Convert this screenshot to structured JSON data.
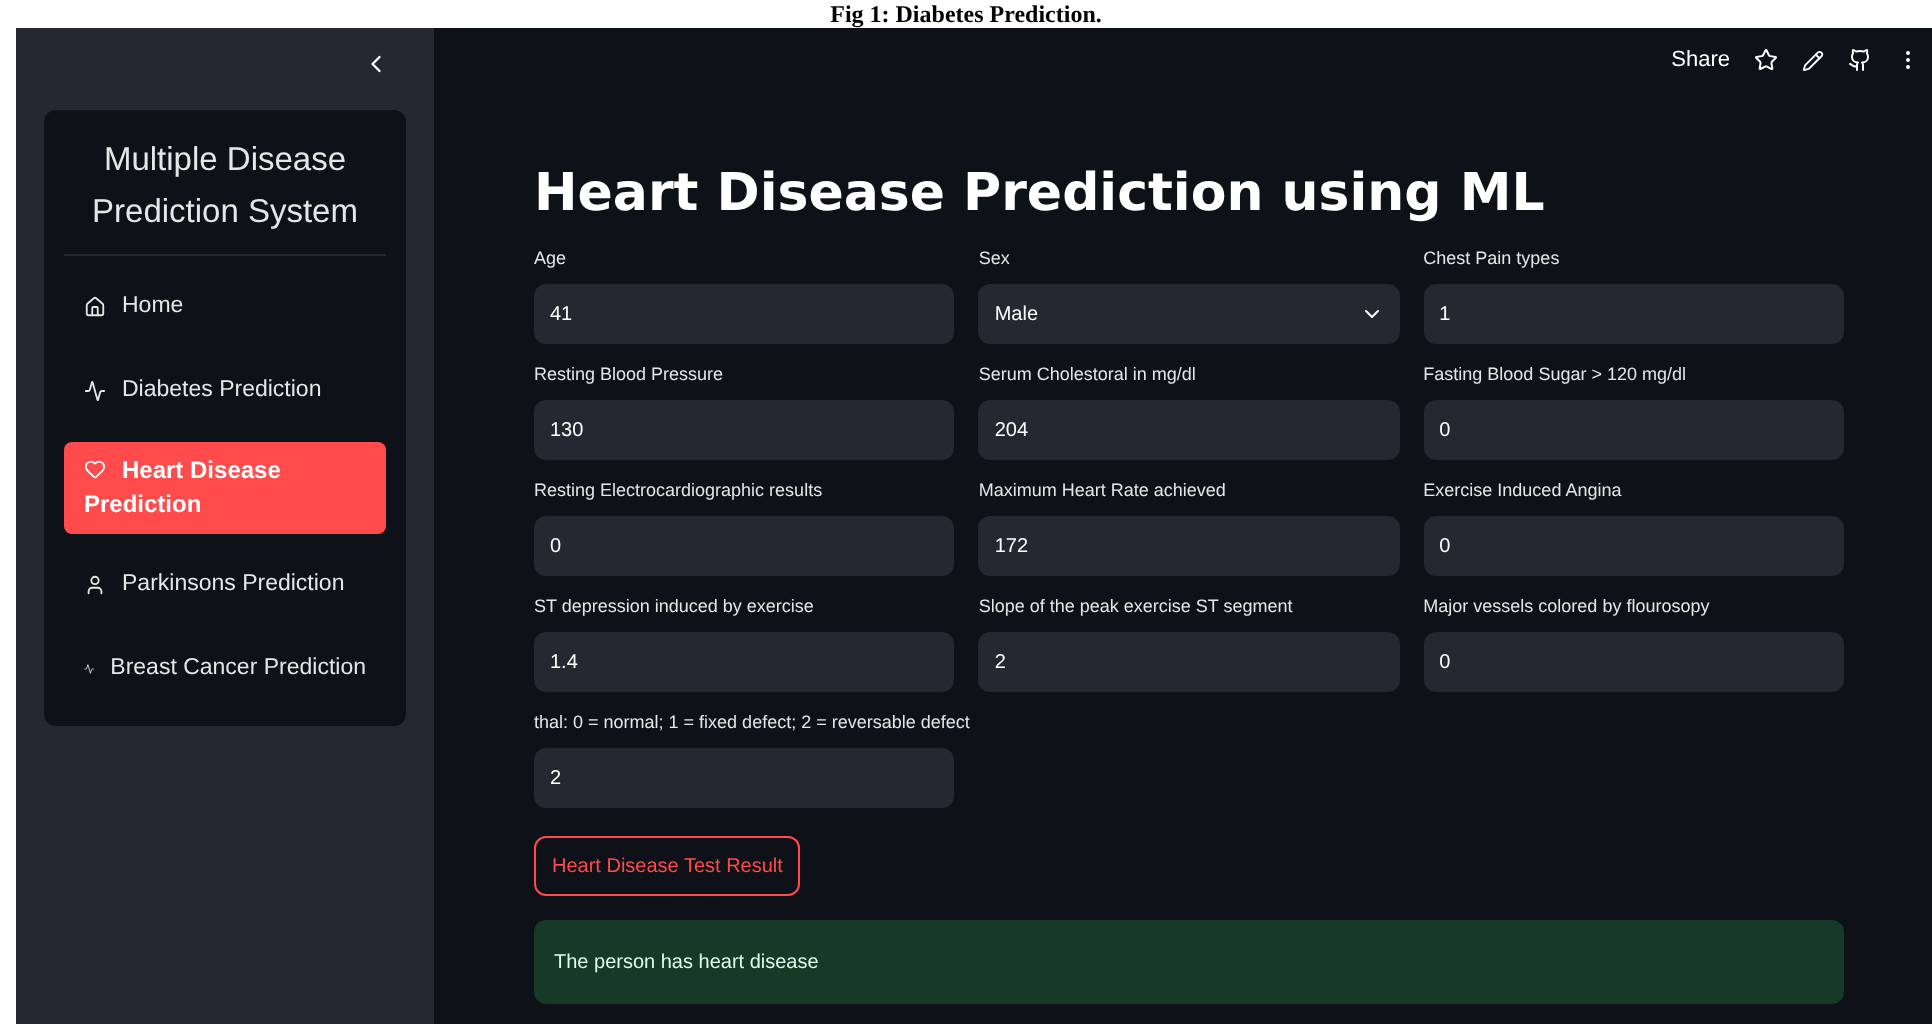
{
  "caption": "Fig 1: Diabetes Prediction.",
  "toolbar": {
    "share": "Share"
  },
  "sidebar": {
    "title": "Multiple Disease Prediction System",
    "items": [
      {
        "label": "Home",
        "kind": "home",
        "selected": false
      },
      {
        "label": "Diabetes Prediction",
        "kind": "pulse",
        "selected": false
      },
      {
        "label": "Heart Disease Prediction",
        "kind": "heart",
        "selected": true
      },
      {
        "label": "Parkinsons Prediction",
        "kind": "person",
        "selected": false
      },
      {
        "label": "Breast Cancer Prediction",
        "kind": "pulse",
        "selected": false
      }
    ]
  },
  "page_title": "Heart Disease Prediction using ML",
  "fields": [
    {
      "label": "Age",
      "value": "41",
      "kind": "number"
    },
    {
      "label": "Sex",
      "value": "Male",
      "kind": "select"
    },
    {
      "label": "Chest Pain types",
      "value": "1",
      "kind": "number"
    },
    {
      "label": "Resting Blood Pressure",
      "value": "130",
      "kind": "number"
    },
    {
      "label": "Serum Cholestoral in mg/dl",
      "value": "204",
      "kind": "number"
    },
    {
      "label": "Fasting Blood Sugar > 120 mg/dl",
      "value": "0",
      "kind": "number"
    },
    {
      "label": "Resting Electrocardiographic results",
      "value": "0",
      "kind": "number"
    },
    {
      "label": "Maximum Heart Rate achieved",
      "value": "172",
      "kind": "number"
    },
    {
      "label": "Exercise Induced Angina",
      "value": "0",
      "kind": "number"
    },
    {
      "label": "ST depression induced by exercise",
      "value": "1.4",
      "kind": "number"
    },
    {
      "label": "Slope of the peak exercise ST segment",
      "value": "2",
      "kind": "number"
    },
    {
      "label": "Major vessels colored by flourosopy",
      "value": "0",
      "kind": "number"
    },
    {
      "label": "thal: 0 = normal; 1 = fixed defect; 2 = reversable defect",
      "value": "2",
      "kind": "number"
    }
  ],
  "button": "Heart Disease Test Result",
  "result": "The person has heart disease"
}
